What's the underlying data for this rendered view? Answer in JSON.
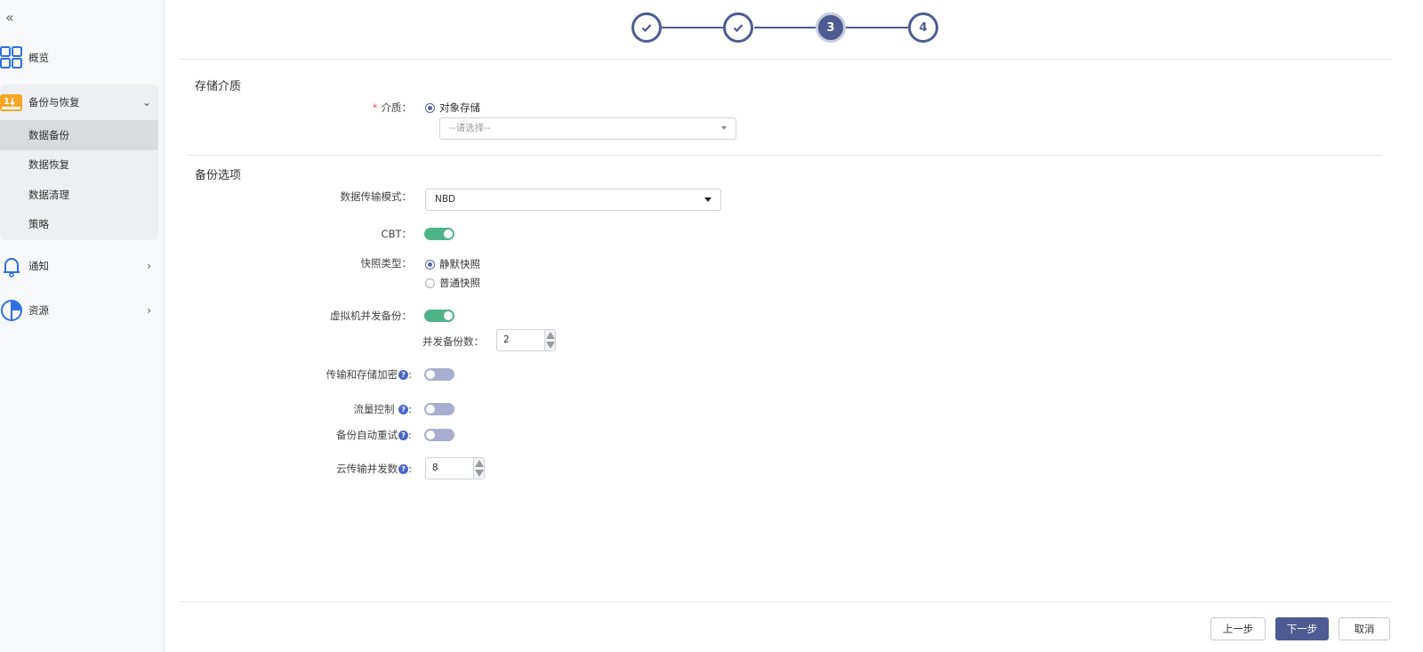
{
  "sidebar": {
    "collapse_icon": "«",
    "items": [
      {
        "label": "概览",
        "icon": "grid-icon"
      },
      {
        "label": "备份与恢复",
        "icon": "backup-icon"
      },
      {
        "label": "通知",
        "icon": "bell-icon"
      },
      {
        "label": "资源",
        "icon": "pie-icon"
      }
    ],
    "submenu": [
      {
        "label": "数据备份",
        "active": true
      },
      {
        "label": "数据恢复",
        "active": false
      },
      {
        "label": "数据清理",
        "active": false
      },
      {
        "label": "策略",
        "active": false
      }
    ]
  },
  "stepper": {
    "current": 3,
    "steps": [
      {
        "label": "",
        "state": "done"
      },
      {
        "label": "",
        "state": "done"
      },
      {
        "label": "3",
        "state": "current"
      },
      {
        "label": "4",
        "state": "pending"
      }
    ]
  },
  "storage": {
    "section_title": "存储介质",
    "medium_label": "介质：",
    "required_mark": "*",
    "medium_option": "对象存储",
    "select_placeholder": "--请选择--"
  },
  "backup": {
    "section_title": "备份选项",
    "transfer_mode_label": "数据传输模式：",
    "transfer_mode_value": "NBD",
    "cbt_label": "CBT：",
    "cbt_on": true,
    "snapshot_label": "快照类型：",
    "snapshot_options": [
      {
        "label": "静默快照",
        "selected": true
      },
      {
        "label": "普通快照",
        "selected": false
      }
    ],
    "vm_concurrent_label": "虚拟机并发备份：",
    "vm_concurrent_on": true,
    "concurrent_count_label": "并发备份数：",
    "concurrent_count_value": "2",
    "encryption_label": "传输和存储加密",
    "encryption_on": false,
    "flow_control_label": "流量控制",
    "flow_control_on": false,
    "auto_retry_label": "备份自动重试",
    "auto_retry_on": false,
    "cloud_concurrency_label": "云传输并发数",
    "cloud_concurrency_value": "8",
    "colon": ":"
  },
  "footer": {
    "prev_label": "上一步",
    "next_label": "下一步",
    "cancel_label": "取消"
  },
  "colors": {
    "primary": "#4c5c93",
    "toggle_on": "#4fb38a",
    "toggle_off": "#a9aed0",
    "help": "#4a66c9",
    "required": "#e2554b"
  }
}
